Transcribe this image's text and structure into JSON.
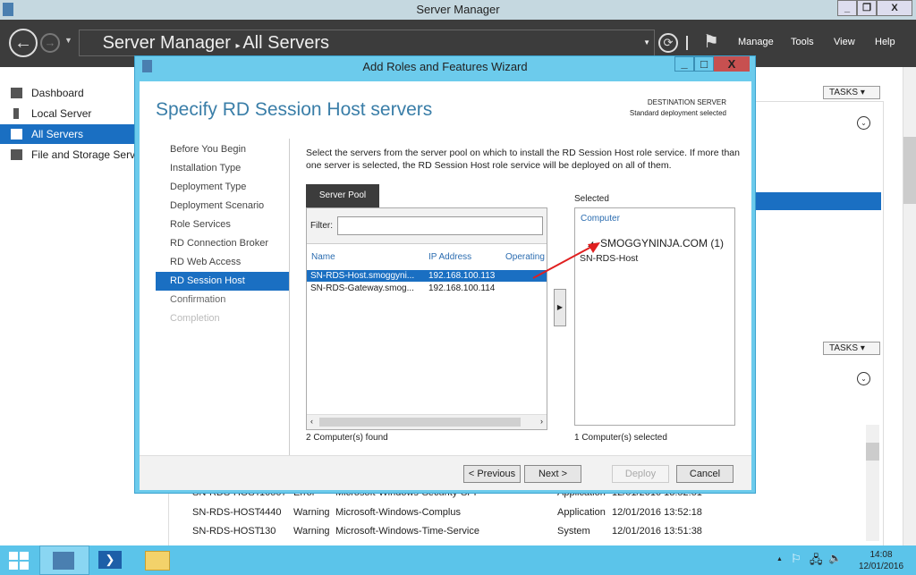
{
  "window": {
    "title": "Server Manager",
    "min": "_",
    "restore": "❐",
    "close": "X"
  },
  "toolbar": {
    "breadcrumb_root": "Server Manager",
    "breadcrumb_page": "All Servers",
    "menus": [
      "Manage",
      "Tools",
      "View",
      "Help"
    ]
  },
  "sidebar": {
    "items": [
      {
        "label": "Dashboard"
      },
      {
        "label": "Local Server"
      },
      {
        "label": "All Servers"
      },
      {
        "label": "File and Storage Services"
      }
    ]
  },
  "main": {
    "tasks_label": "TASKS",
    "events": [
      {
        "server": "SN-RDS-HOST",
        "id": "10507",
        "severity": "Error",
        "source": "Microsoft-Windows-Security-SPP",
        "log": "Application",
        "time": "12/01/2016 13:52:51"
      },
      {
        "server": "SN-RDS-HOST",
        "id": "4440",
        "severity": "Warning",
        "source": "Microsoft-Windows-Complus",
        "log": "Application",
        "time": "12/01/2016 13:52:18"
      },
      {
        "server": "SN-RDS-HOST",
        "id": "130",
        "severity": "Warning",
        "source": "Microsoft-Windows-Time-Service",
        "log": "System",
        "time": "12/01/2016 13:51:38"
      }
    ]
  },
  "wizard": {
    "title": "Add Roles and Features Wizard",
    "heading": "Specify RD Session Host servers",
    "dest_label": "DESTINATION SERVER",
    "dest_value": "Standard deployment selected",
    "steps": [
      "Before You Begin",
      "Installation Type",
      "Deployment Type",
      "Deployment Scenario",
      "Role Services",
      "RD Connection Broker",
      "RD Web Access",
      "RD Session Host",
      "Confirmation",
      "Completion"
    ],
    "description": "Select the servers from the server pool on which to install the RD Session Host role service. If more than one server is selected, the RD Session Host role service will be deployed on all of them.",
    "pool_tab": "Server Pool",
    "filter_label": "Filter:",
    "filter_value": "",
    "columns": [
      "Name",
      "IP Address",
      "Operating"
    ],
    "servers": [
      {
        "name": "SN-RDS-Host.smoggyni...",
        "ip": "192.168.100.113"
      },
      {
        "name": "SN-RDS-Gateway.smog...",
        "ip": "192.168.100.114"
      }
    ],
    "found": "2 Computer(s) found",
    "add_arrow": "▶",
    "selected_label": "Selected",
    "selected_column": "Computer",
    "selected_group": "SMOGGYNINJA.COM (1)",
    "selected_item": "SN-RDS-Host",
    "selected_count": "1 Computer(s) selected",
    "buttons": {
      "previous": "< Previous",
      "next": "Next >",
      "deploy": "Deploy",
      "cancel": "Cancel"
    }
  },
  "taskbar": {
    "time": "14:08",
    "date": "12/01/2016"
  },
  "colors": {
    "accent": "#1a6fc2",
    "wizard_frame": "#6ccbec",
    "arrow": "#e02020"
  }
}
